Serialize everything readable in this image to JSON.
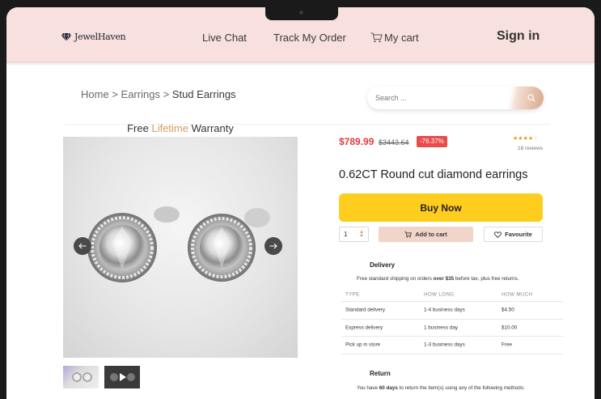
{
  "header": {
    "logo_text": "JewelHaven",
    "nav": {
      "live_chat": "Live Chat",
      "track_order": "Track My Order",
      "cart": "My cart"
    },
    "sign_in": "Sign in"
  },
  "breadcrumb": {
    "home": "Home",
    "separator": ">",
    "earrings": "Earrings",
    "current": "Stud Earrings"
  },
  "search": {
    "placeholder": "Search ..."
  },
  "warranty": {
    "prefix": "Free",
    "accent": "Lifetime",
    "suffix": "Warranty"
  },
  "product": {
    "price": "$789.99",
    "old_price": "$3443.64",
    "discount": "-76.37%",
    "rating": 4,
    "rating_max": 5,
    "reviews": "18 reviews",
    "title": "0.62CT Round cut diamond earrings",
    "buy_now": "Buy Now",
    "quantity": "1",
    "add_to_cart": "Add to cart",
    "favourite": "Favourite"
  },
  "delivery": {
    "heading": "Delivery",
    "note_prefix": "Free standard shipping on orders",
    "note_bold": "over $35",
    "note_suffix": "before tax, plus free returns.",
    "columns": [
      "TYPE",
      "HOW LONG",
      "HOW MUCH"
    ],
    "rows": [
      [
        "Standard delivery",
        "1-4 business days",
        "$4.50"
      ],
      [
        "Express delivery",
        "1 business day",
        "$10.00"
      ],
      [
        "Pick up in store",
        "1-3 business days",
        "Free"
      ]
    ]
  },
  "return": {
    "heading": "Return",
    "note_prefix": "You have",
    "note_bold": "60 days",
    "note_suffix": "to return the item(s) using any of the following methods:"
  },
  "colors": {
    "header_bg": "#f7e0dd",
    "price_red": "#e23b3b",
    "discount_bg": "#e94b4b",
    "buy_now_yellow": "#ffcd1d",
    "add_cart_bg": "#f1d5c8",
    "accent_gold": "#d39a63",
    "star_orange": "#e39a2a"
  },
  "icons": {
    "logo": "diamond-icon",
    "cart": "cart-icon",
    "search": "search-icon",
    "prev": "arrow-left-icon",
    "next": "arrow-right-icon",
    "favourite": "heart-icon",
    "add_cart": "cart-icon",
    "play": "play-icon"
  }
}
